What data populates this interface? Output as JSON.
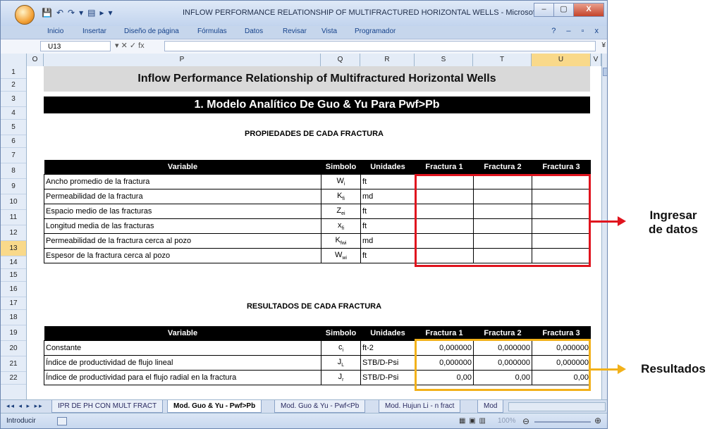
{
  "window": {
    "title": "INFLOW PERFORMANCE RELATIONSHIP OF MULTIFRACTURED HORIZONTAL WELLS - Microsoft Excel",
    "office_button_label": "",
    "controls": [
      "–",
      "▢",
      "X"
    ]
  },
  "quick_access": [
    "💾",
    "↶",
    "↷",
    "▾",
    "▤",
    "▸",
    "▾"
  ],
  "ribbon": {
    "tabs": [
      "Inicio",
      "Insertar",
      "Diseño de página",
      "Fórmulas",
      "Datos",
      "Revisar",
      "Vista",
      "Programador"
    ],
    "right_controls": "? – ▫ x"
  },
  "formula_bar": {
    "name_box": "U13",
    "buttons": "▾  ✕ ✓ fx",
    "value": ""
  },
  "columns": [
    "O",
    "P",
    "Q",
    "R",
    "S",
    "T",
    "U",
    "V"
  ],
  "selected_column": "U",
  "rows": [
    "1",
    "2",
    "3",
    "4",
    "5",
    "6",
    "7",
    "8",
    "9",
    "10",
    "11",
    "12",
    "13",
    "14",
    "15",
    "16",
    "17",
    "18",
    "19",
    "20",
    "21",
    "22"
  ],
  "selected_row": "13",
  "sheet": {
    "main_title": "Inflow Performance Relationship of Multifractured Horizontal Wells",
    "subtitle": "1.   Modelo Analítico De Guo & Yu Para Pwf>Pb",
    "section1_title": "PROPIEDADES DE CADA FRACTURA",
    "section2_title": "RESULTADOS DE CADA FRACTURA",
    "headers": [
      "Variable",
      "Simbolo",
      "Unidades",
      "Fractura 1",
      "Fractura 2",
      "Fractura 3"
    ],
    "properties": [
      {
        "variable": "Ancho promedio de la fractura",
        "symbol": "W",
        "sub": "i",
        "units": "ft"
      },
      {
        "variable": "Permeabilidad de la fractura",
        "symbol": "K",
        "sub": "fi",
        "units": "md"
      },
      {
        "variable": "Espacio medio de las fracturas",
        "symbol": "Z",
        "sub": "ei",
        "units": "ft"
      },
      {
        "variable": "Longitud media de las fracturas",
        "symbol": "x",
        "sub": "fi",
        "units": "ft"
      },
      {
        "variable": "Permeabilidad de la fractura cerca al pozo",
        "symbol": "K",
        "sub": "fwi",
        "units": "md"
      },
      {
        "variable": "Espesor de la fractura cerca al pozo",
        "symbol": "W",
        "sub": "wi",
        "units": "ft"
      }
    ],
    "results": [
      {
        "variable": "Constante",
        "symbol": "c",
        "sub": "i",
        "units": "ft-2",
        "values": [
          "0,000000",
          "0,000000",
          "0,000000"
        ]
      },
      {
        "variable": "Índice de productividad de flujo lineal",
        "symbol": "J",
        "sub": "L",
        "units": "STB/D-Psi",
        "values": [
          "0,000000",
          "0,000000",
          "0,000000"
        ]
      },
      {
        "variable": "Índice de productividad para el flujo radial en la fractura",
        "symbol": "J",
        "sub": "r",
        "units": "STB/D-Psi",
        "values": [
          "0,00",
          "0,00",
          "0,00"
        ]
      }
    ]
  },
  "sheet_tabs": {
    "nav": "◂◂ ◂ ▸ ▸▸",
    "tabs": [
      "IPR DE PH CON MULT FRACT",
      "Mod. Guo & Yu - Pwf>Pb",
      "Mod. Guo & Yu - Pwf<Pb",
      "Mod. Hujun Li - n fract",
      "Mod"
    ],
    "active_index": 1
  },
  "status": {
    "mode": "Introducir",
    "zoom": "100%",
    "views": "▦ ▣ ▥",
    "zoom_minus": "⊖",
    "zoom_plus": "⊕"
  },
  "annotations": {
    "input_label_line1": "Ingresar",
    "input_label_line2": "de datos",
    "result_label": "Resultados",
    "input_color": "#e0141e",
    "result_color": "#f2b11a"
  }
}
